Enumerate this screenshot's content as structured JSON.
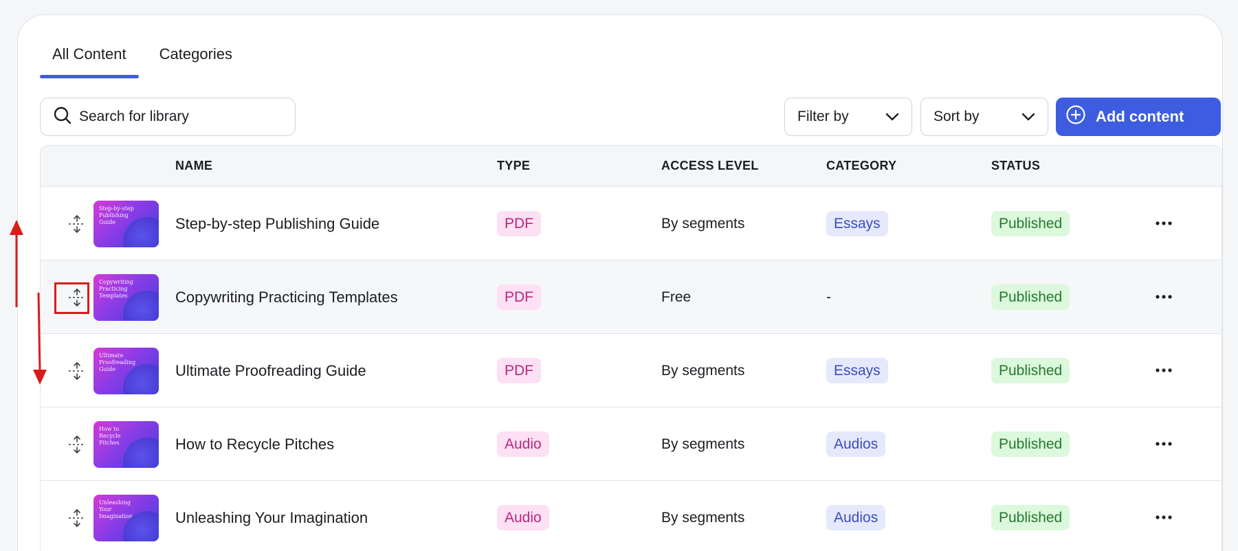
{
  "tabs": [
    {
      "label": "All Content",
      "active": true
    },
    {
      "label": "Categories",
      "active": false
    }
  ],
  "toolbar": {
    "search_placeholder": "Search for library",
    "filter_label": "Filter by",
    "sort_label": "Sort by",
    "add_label": "Add content"
  },
  "table": {
    "headers": {
      "name": "NAME",
      "type": "TYPE",
      "access": "ACCESS LEVEL",
      "category": "CATEGORY",
      "status": "STATUS"
    },
    "rows": [
      {
        "thumb_text": "Step-by-step Publishing Guide",
        "name": "Step-by-step Publishing Guide",
        "type": "PDF",
        "access": "By segments",
        "category": "Essays",
        "status": "Published"
      },
      {
        "thumb_text": "Copywriting Practicing Templates",
        "name": "Copywriting Practicing Templates",
        "type": "PDF",
        "access": "Free",
        "category": "-",
        "status": "Published"
      },
      {
        "thumb_text": "Ultimate Proofreading Guide",
        "name": "Ultimate Proofreading Guide",
        "type": "PDF",
        "access": "By segments",
        "category": "Essays",
        "status": "Published"
      },
      {
        "thumb_text": "How to Recycle Pitches",
        "name": "How to Recycle Pitches",
        "type": "Audio",
        "access": "By segments",
        "category": "Audios",
        "status": "Published"
      },
      {
        "thumb_text": "Unleashing Your Imagination",
        "name": "Unleashing Your Imagination",
        "type": "Audio",
        "access": "By segments",
        "category": "Audios",
        "status": "Published"
      }
    ]
  },
  "colors": {
    "accent": "#3d5ce0",
    "annotation": "#d91b1b",
    "type_pill_bg": "#fde0f3",
    "category_pill_bg": "#e6e9fb",
    "status_pill_bg": "#dcf8dd"
  },
  "icons": {
    "search": "search-icon",
    "chevron": "chevron-down-icon",
    "add": "plus-circle-icon",
    "drag": "drag-handle-icon",
    "more": "more-horizontal-icon"
  }
}
